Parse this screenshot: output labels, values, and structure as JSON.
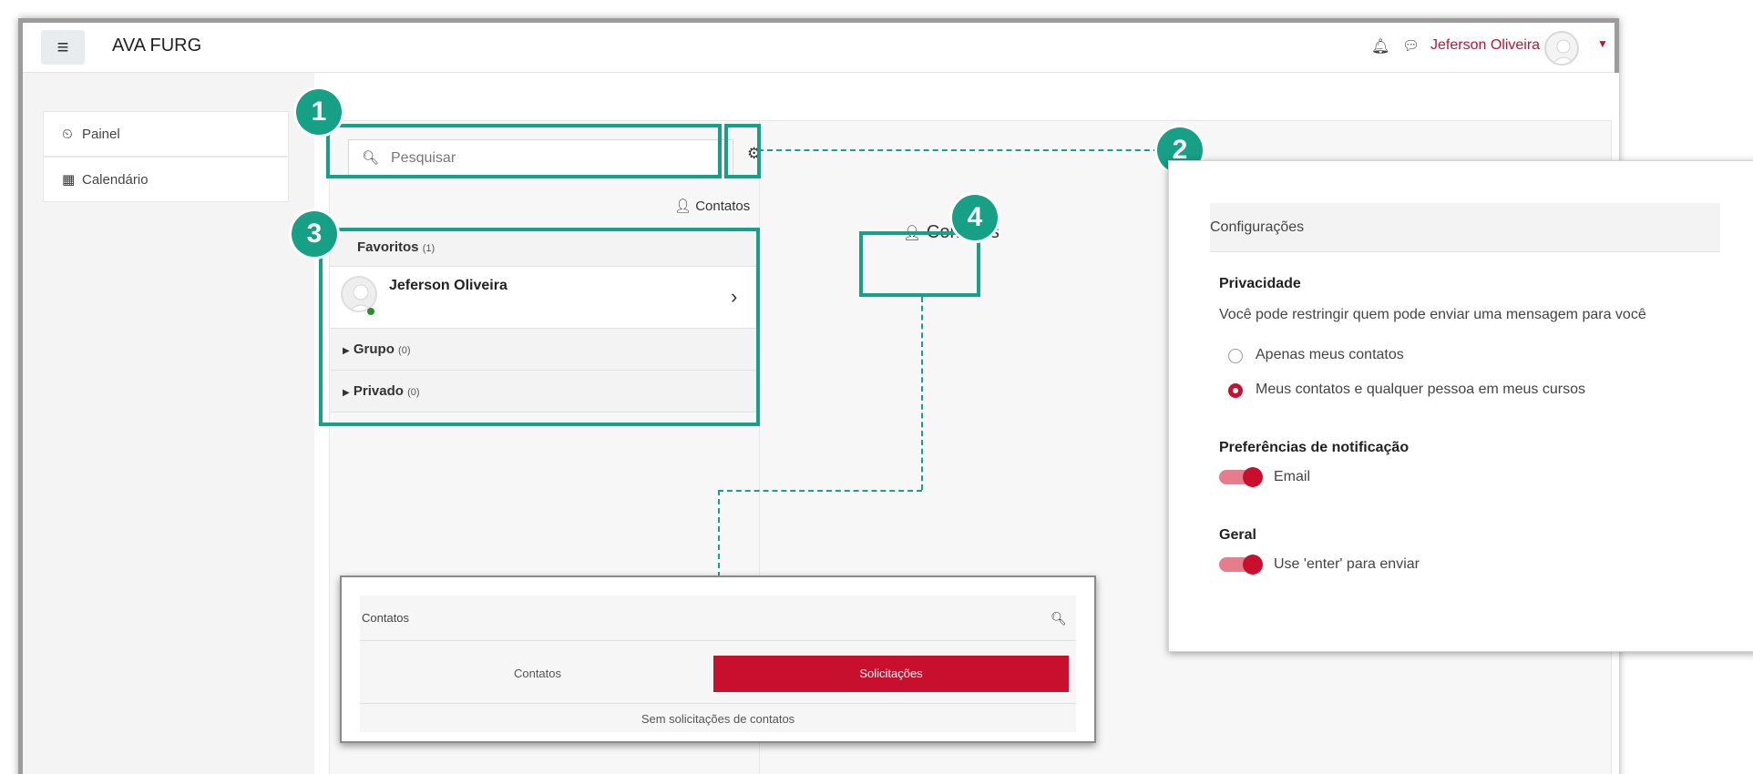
{
  "header": {
    "menu_icon": "hamburger-icon",
    "brand": "AVA FURG",
    "user_name": "Jeferson Oliveira"
  },
  "sidebar": {
    "items": [
      {
        "label": "Painel",
        "icon": "dashboard-icon"
      },
      {
        "label": "Calendário",
        "icon": "calendar-icon"
      }
    ]
  },
  "messages": {
    "search_placeholder": "Pesquisar",
    "contacts_link": "Contatos",
    "favorites": {
      "label": "Favoritos",
      "count": "(1)"
    },
    "favorite_contact": "Jeferson Oliveira",
    "groups": [
      {
        "label": "Grupo",
        "count": "(0)"
      },
      {
        "label": "Privado",
        "count": "(0)"
      }
    ],
    "contacts_button": "Contatos"
  },
  "callouts": [
    "1",
    "2",
    "3",
    "4"
  ],
  "settings_popup": {
    "title": "Configurações",
    "privacy_heading": "Privacidade",
    "privacy_text": "Você pode restringir quem pode enviar uma mensagem para você",
    "radio_options": [
      {
        "label": "Apenas meus contatos",
        "selected": false
      },
      {
        "label": "Meus contatos e qualquer pessoa em meus cursos",
        "selected": true
      }
    ],
    "notif_heading": "Preferências de notificação",
    "notif_email": "Email",
    "general_heading": "Geral",
    "general_enter": "Use 'enter' para enviar"
  },
  "contacts_popup": {
    "title": "Contatos",
    "tab_contacts": "Contatos",
    "tab_requests": "Solicitações",
    "empty_text": "Sem solicitações de contatos"
  },
  "colors": {
    "accent": "#c8102e",
    "callout": "#16a085"
  }
}
